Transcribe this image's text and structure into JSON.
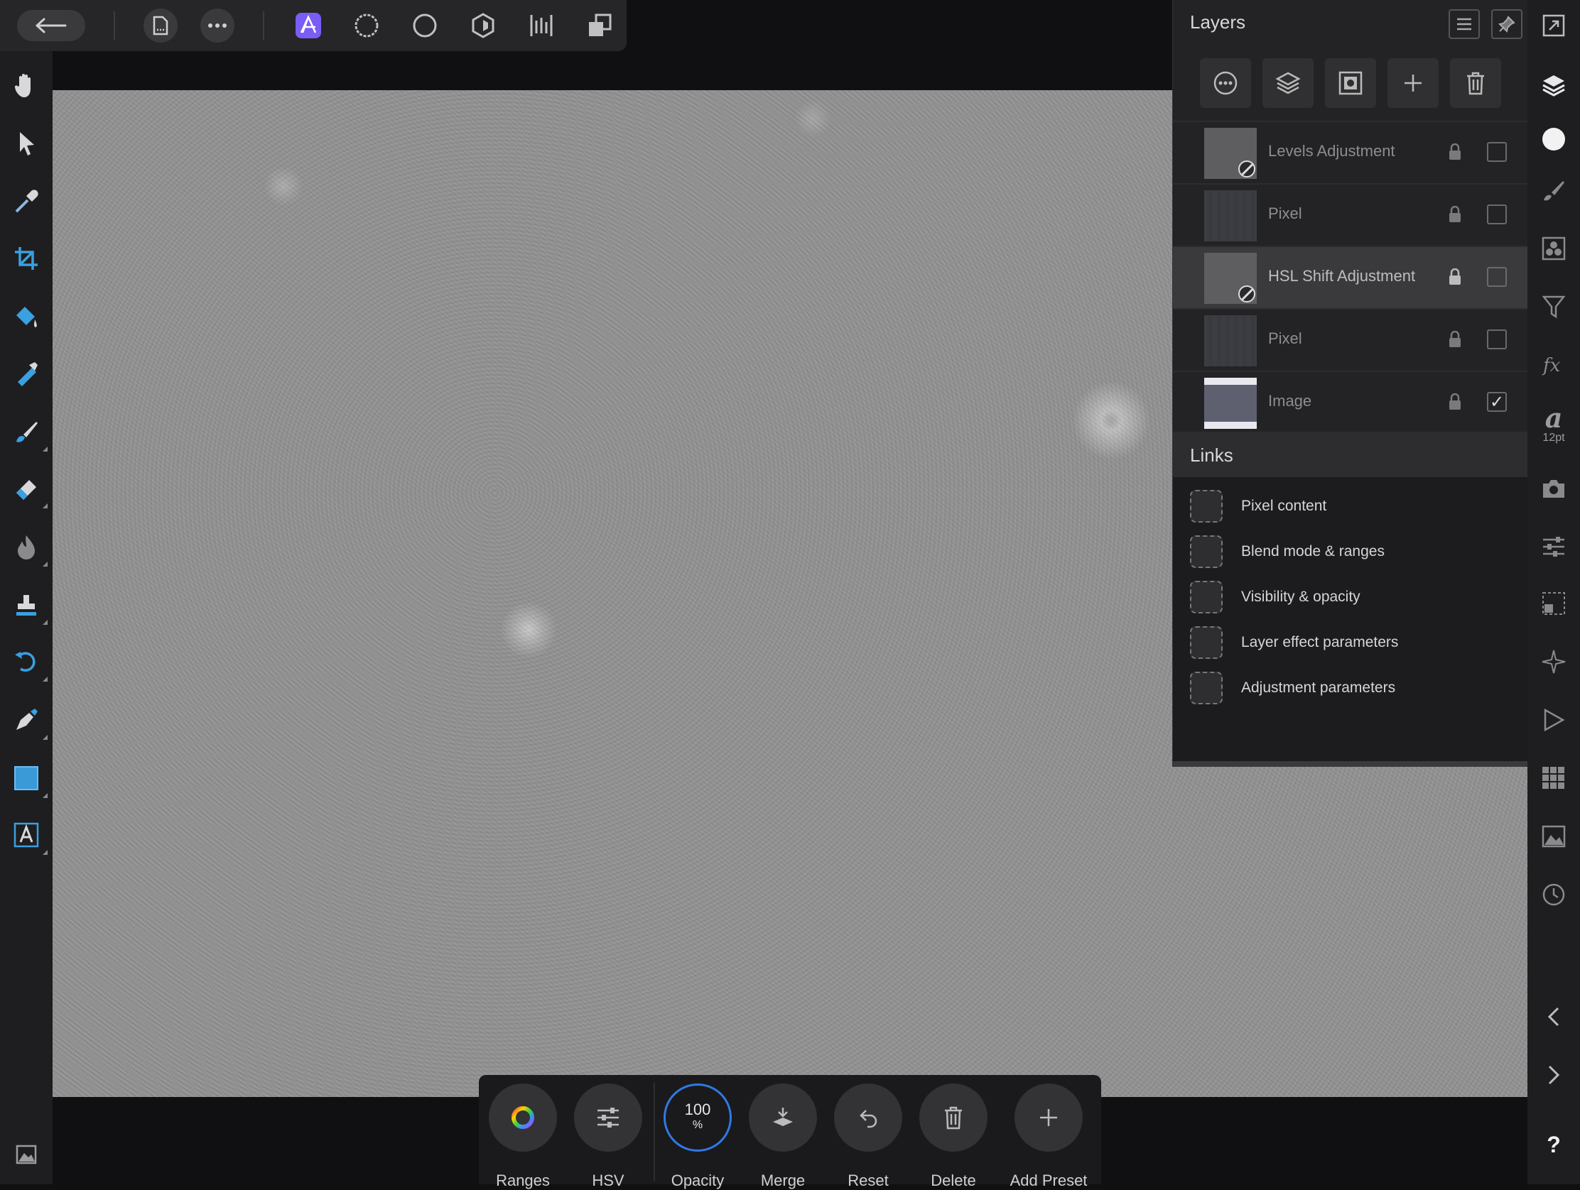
{
  "layers_panel": {
    "title": "Layers",
    "rows": [
      {
        "name": "Levels Adjustment",
        "checked": false
      },
      {
        "name": "Pixel",
        "checked": false
      },
      {
        "name": "HSL Shift Adjustment",
        "checked": false,
        "selected": true
      },
      {
        "name": "Pixel",
        "checked": false
      },
      {
        "name": "Image",
        "checked": true
      }
    ],
    "checkmark": "✓"
  },
  "links_panel": {
    "title": "Links",
    "items": [
      "Pixel content",
      "Blend mode & ranges",
      "Visibility & opacity",
      "Layer effect parameters",
      "Adjustment parameters"
    ]
  },
  "right_strip": {
    "font_size_label": "12pt",
    "text_glyph": "a",
    "help": "?"
  },
  "context_toolbar": {
    "items": [
      {
        "label": "Ranges",
        "icon": "color-wheel-icon"
      },
      {
        "label": "HSV",
        "icon": "sliders-icon"
      },
      {
        "label": "Opacity",
        "value": "100",
        "unit": "%"
      },
      {
        "label": "Merge",
        "icon": "merge-icon"
      },
      {
        "label": "Reset",
        "icon": "undo-icon"
      },
      {
        "label": "Delete",
        "icon": "trash-icon"
      },
      {
        "label": "Add Preset",
        "icon": "plus-icon"
      }
    ]
  },
  "colors": {
    "accent_persona": "#7b5cf5",
    "panel_bg": "#232325",
    "canvas_gray": "#939393",
    "opacity_ring": "#2f7ae5"
  }
}
